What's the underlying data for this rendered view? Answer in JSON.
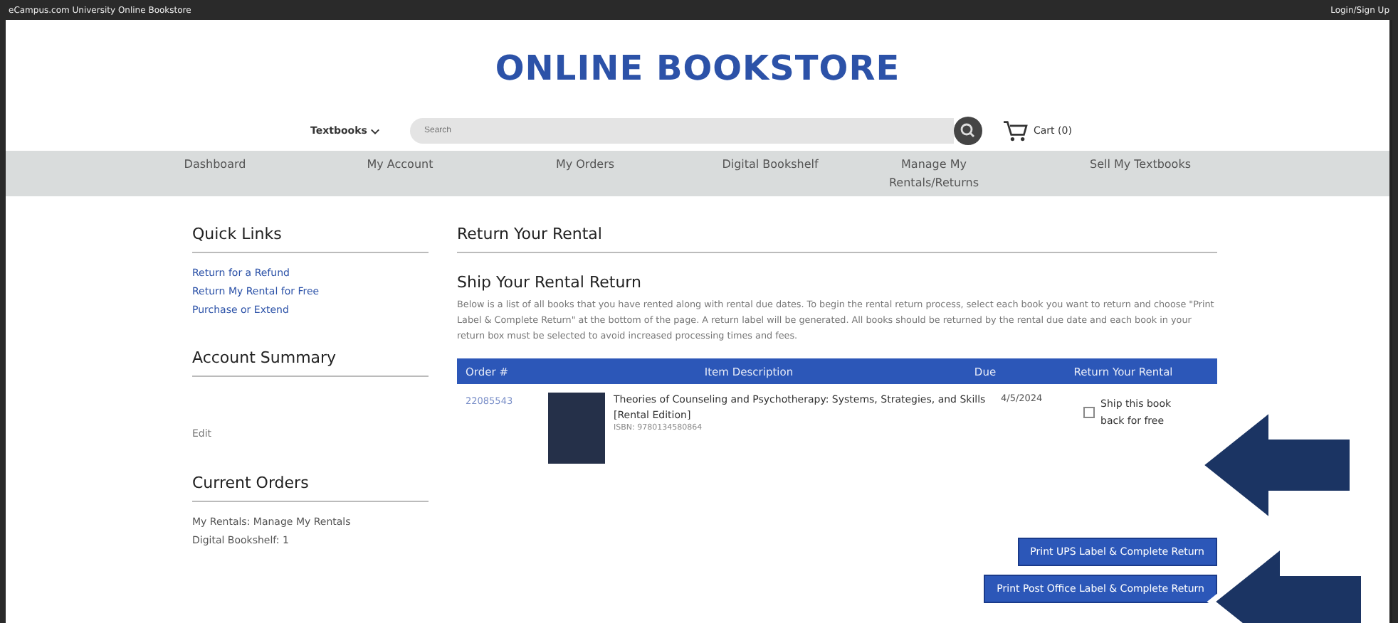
{
  "top_bar": {
    "left": "eCampus.com University Online Bookstore",
    "right": "Login/Sign Up"
  },
  "title": "ONLINE BOOKSTORE",
  "search_row": {
    "category": "Textbooks",
    "placeholder": "Search",
    "cart": "Cart (0)"
  },
  "nav": [
    "Dashboard",
    "My Account",
    "My Orders",
    "Digital Bookshelf",
    "Manage My Rentals/Returns",
    "Sell My Textbooks"
  ],
  "sidebar": {
    "quick_links_title": "Quick Links",
    "quick_links": [
      "Return for a Refund",
      "Return My Rental for Free",
      "Purchase or Extend"
    ],
    "account_summary_title": "Account Summary",
    "account_summary_link": "Edit",
    "current_orders_title": "Current Orders",
    "current_orders": [
      "My Rentals: Manage My Rentals",
      "Digital Bookshelf: 1"
    ]
  },
  "main": {
    "title": "Return Your Rental",
    "subtitle": "Ship Your Rental Return",
    "description": "Below is a list of all books that you have rented along with rental due dates. To begin the rental return process, select each book you want to return and choose \"Print Label & Complete Return\" at the bottom of the page. A return label will be generated. All books should be returned by the rental due date and each book in your return box must be selected to avoid increased processing times and fees.",
    "table": {
      "columns": [
        "Order #",
        "Item Description",
        "Due",
        "Return Your Rental"
      ],
      "rows": [
        {
          "order": "22085543",
          "title": "Theories of Counseling and Psychotherapy: Systems, Strategies, and Skills [Rental Edition]",
          "isbn": "ISBN: 9780134580864",
          "due": "4/5/2024",
          "return_label": "Ship this book back for free",
          "checked": false
        }
      ]
    },
    "buttons": [
      "Print UPS Label & Complete Return",
      "Print Post Office Label & Complete Return"
    ]
  }
}
